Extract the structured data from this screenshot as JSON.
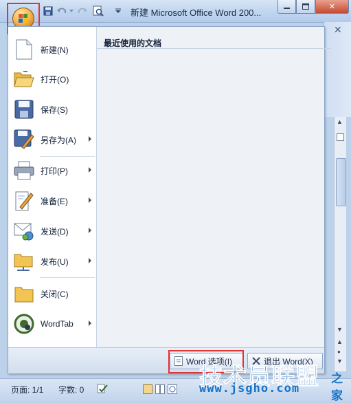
{
  "window": {
    "title": "新建 Microsoft Office Word 200...",
    "controls": [
      "minimize",
      "maximize",
      "close"
    ]
  },
  "quick_access": [
    "save-icon",
    "undo-icon",
    "redo-icon",
    "print-preview-icon",
    "customize-dropdown-icon"
  ],
  "office_menu": {
    "recent_header": "最近使用的文档",
    "items": [
      {
        "label": "新建(N)",
        "icon": "new-document-icon",
        "submenu": false
      },
      {
        "label": "打开(O)",
        "icon": "open-folder-icon",
        "submenu": false
      },
      {
        "label": "保存(S)",
        "icon": "save-icon",
        "submenu": false
      },
      {
        "label": "另存为(A)",
        "icon": "save-as-icon",
        "submenu": true
      },
      {
        "label": "打印(P)",
        "icon": "printer-icon",
        "submenu": true
      },
      {
        "label": "准备(E)",
        "icon": "prepare-icon",
        "submenu": true
      },
      {
        "label": "发送(D)",
        "icon": "send-icon",
        "submenu": true
      },
      {
        "label": "发布(U)",
        "icon": "publish-icon",
        "submenu": true
      },
      {
        "label": "关闭(C)",
        "icon": "close-folder-icon",
        "submenu": false
      },
      {
        "label": "WordTab",
        "icon": "wordtab-icon",
        "submenu": true
      }
    ],
    "word_options_label": "Word 选项(I)",
    "exit_word_label": "退出 Word(X)"
  },
  "status": {
    "page": "页面: 1/1",
    "words": "字数: 0"
  },
  "watermark": {
    "main": "技术员联盟",
    "sub": "之家",
    "url": "www.jsgho.com"
  },
  "colors": {
    "highlight_border": "#e03535",
    "ribbon_blue": "#c3d7f0",
    "watermark_blue": "#1672c8"
  }
}
